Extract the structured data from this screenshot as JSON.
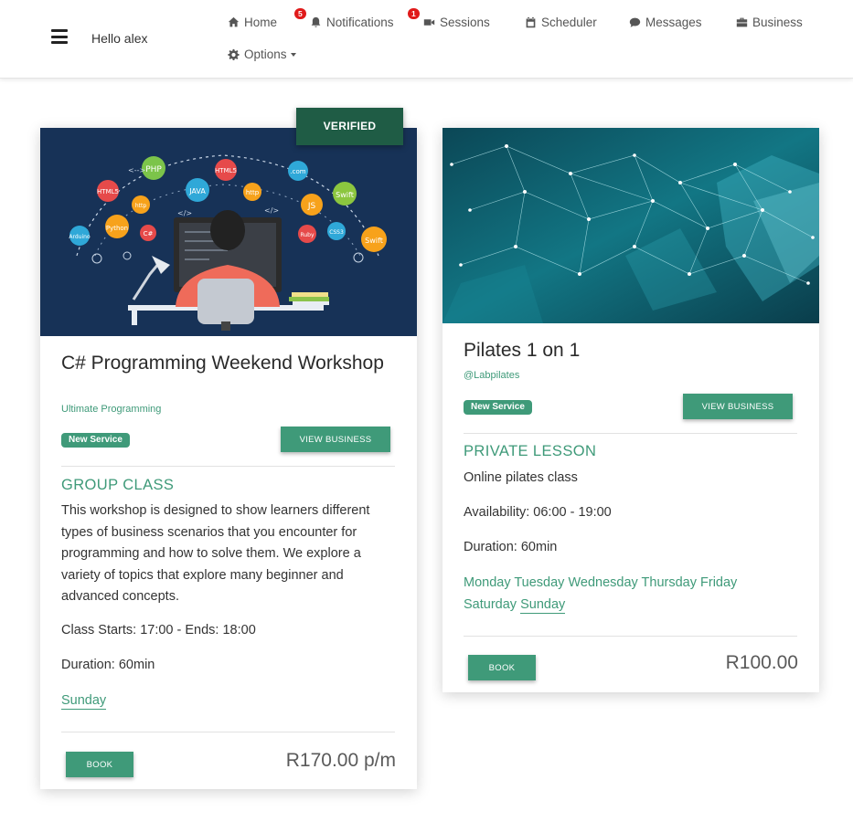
{
  "nav": {
    "greeting": "Hello alex",
    "items": [
      {
        "label": "Home",
        "icon": "home-icon"
      },
      {
        "label": "Notifications",
        "icon": "bell-icon",
        "badge": "5"
      },
      {
        "label": "Sessions",
        "icon": "video-icon",
        "badge": "1"
      },
      {
        "label": "Scheduler",
        "icon": "calendar-icon"
      },
      {
        "label": "Messages",
        "icon": "chat-icon"
      },
      {
        "label": "Business",
        "icon": "briefcase-icon"
      },
      {
        "label": "Options",
        "icon": "gear-icon"
      }
    ]
  },
  "cards": [
    {
      "verified_label": "VERIFIED",
      "image_icon": "programming-illustration",
      "title": "C# Programming Weekend Workshop",
      "business": "Ultimate Programming",
      "badge": "New Service",
      "view_button": "VIEW BUSINESS",
      "class_type": "GROUP CLASS",
      "description": "This workshop is designed to show learners different types of business scenarios that you encounter for programming and how to solve them. We explore a variety of topics that explore many beginner and advanced concepts.",
      "times": "Class Starts: 17:00 - Ends: 18:00",
      "duration": "Duration: 60min",
      "days": "Sunday",
      "book_button": "BOOK",
      "price": "R170.00 p/m"
    },
    {
      "image_icon": "network-abstract-image",
      "title": "Pilates 1 on 1",
      "business": "@Labpilates",
      "badge": "New Service",
      "view_button": "VIEW BUSINESS",
      "class_type": "PRIVATE LESSON",
      "description": "Online pilates class",
      "availability": "Availability: 06:00 - 19:00",
      "duration": "Duration: 60min",
      "days_line1": "Monday Tuesday Wednesday Thursday Friday",
      "days_line2a": "Saturday",
      "days_line2b": "Sunday",
      "book_button": "BOOK",
      "price": "R100.00"
    }
  ],
  "colors": {
    "accent": "#3f9a79",
    "verified": "#1f5c45",
    "badge_red": "#e01a1a"
  }
}
